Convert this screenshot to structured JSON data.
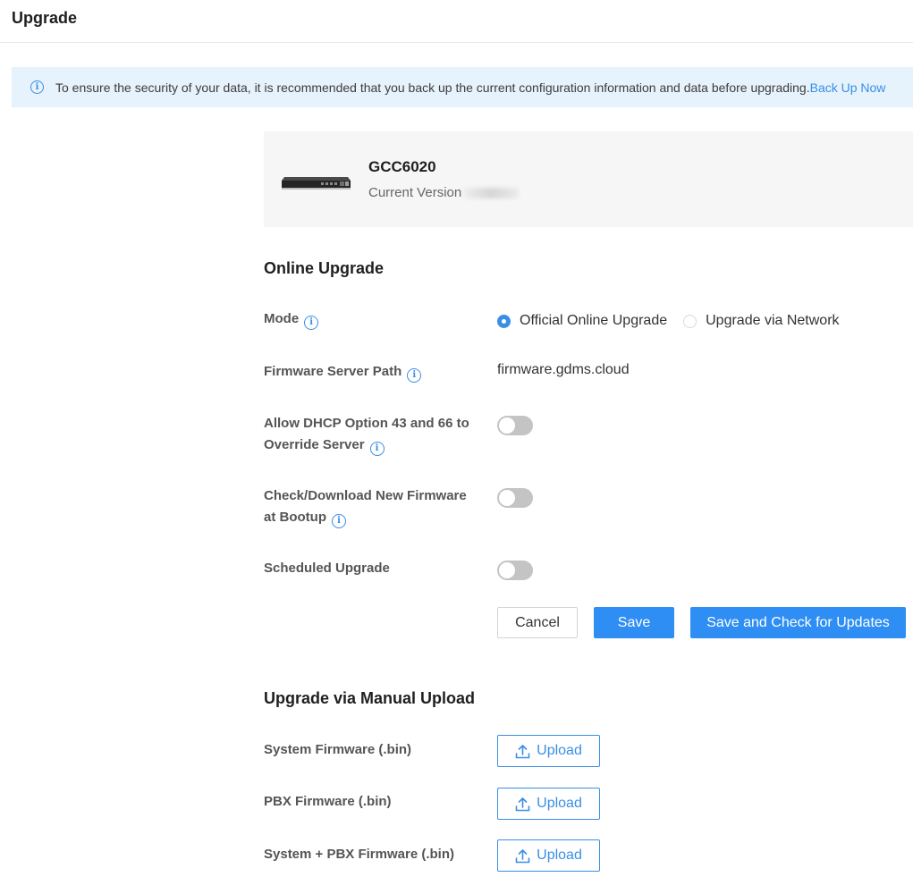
{
  "header": {
    "title": "Upgrade"
  },
  "notice": {
    "text": "To ensure the security of your data, it is recommended that you back up the current configuration information and data before upgrading.",
    "link": "Back Up Now"
  },
  "device": {
    "model": "GCC6020",
    "version_label": "Current Version"
  },
  "online_upgrade": {
    "title": "Online Upgrade",
    "mode_label": "Mode",
    "mode_options": [
      {
        "label": "Official Online Upgrade",
        "checked": true
      },
      {
        "label": "Upgrade via Network",
        "checked": false
      }
    ],
    "server_path_label": "Firmware Server Path",
    "server_path_value": "firmware.gdms.cloud",
    "dhcp_label_line1": "Allow DHCP Option 43 and 66 to",
    "dhcp_label_line2": "Override Server",
    "dhcp_enabled": false,
    "bootup_label_line1": "Check/Download New Firmware",
    "bootup_label_line2": "at Bootup",
    "bootup_enabled": false,
    "scheduled_label": "Scheduled Upgrade",
    "scheduled_enabled": false,
    "buttons": {
      "cancel": "Cancel",
      "save": "Save",
      "save_check": "Save and Check for Updates"
    }
  },
  "manual_upgrade": {
    "title": "Upgrade via Manual Upload",
    "items": [
      {
        "label": "System Firmware (.bin)",
        "button": "Upload"
      },
      {
        "label": "PBX Firmware (.bin)",
        "button": "Upload"
      },
      {
        "label": "System + PBX Firmware (.bin)",
        "button": "Upload"
      }
    ]
  },
  "colors": {
    "accent": "#2f8ef4",
    "notice_bg": "#e6f2fc",
    "toggle_off": "#c4c4c4"
  },
  "icons": {
    "info": "info-circle-icon",
    "upload": "upload-arrow-icon"
  }
}
